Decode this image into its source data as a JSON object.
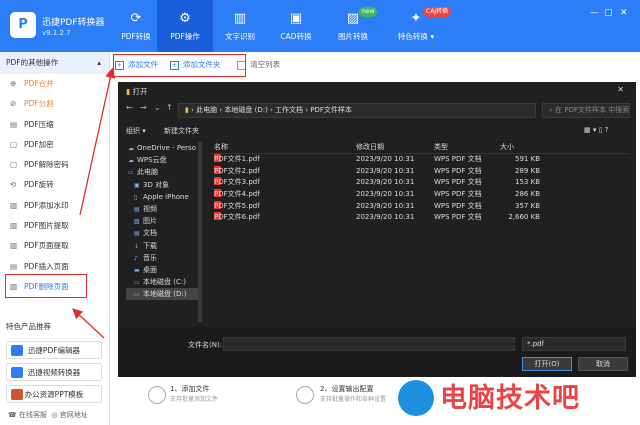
{
  "app": {
    "name": "迅捷PDF转换器",
    "version": "v9.1.2.7",
    "logo": "P"
  },
  "nav": [
    {
      "label": "PDF转换",
      "icon": "refresh-icon"
    },
    {
      "label": "PDF操作",
      "icon": "gear-icon"
    },
    {
      "label": "文字识别",
      "icon": "waveform-icon"
    },
    {
      "label": "CAD转换",
      "icon": "cad-icon"
    },
    {
      "label": "图片转换",
      "icon": "image-icon"
    },
    {
      "label": "特色转换",
      "icon": "special-icon",
      "dropdown": "▾"
    }
  ],
  "badges": {
    "new": "new",
    "caj": "CAJ转换"
  },
  "window": {
    "minimize": "—",
    "restore": "▢",
    "close": "✕"
  },
  "sidebar": {
    "header": "PDF的其他操作",
    "header_arrow": "▴",
    "items": [
      "PDF合并",
      "PDF分割",
      "PDF压缩",
      "PDF加密",
      "PDF解除密码",
      "PDF旋转",
      "PDF添加水印",
      "PDF图片提取",
      "PDF页面提取",
      "PDF插入页面",
      "PDF删除页面"
    ],
    "featured_header": "特色产品推荐",
    "featured": [
      "迅捷PDF编辑器",
      "迅捷视频转换器",
      "办公资源PPT模板"
    ],
    "footer": {
      "online": "在线客服",
      "website": "官网地址"
    }
  },
  "toolbar": {
    "add_file": "添加文件",
    "add_folder": "添加文件夹",
    "clear": "清空列表"
  },
  "dialog": {
    "title": "打开",
    "path": [
      "此电脑",
      "本地磁盘 (D:)",
      "工作文档",
      "PDF文件样本"
    ],
    "search_placeholder": "在 PDF文件样本 中搜索",
    "organize": "组织 ▾",
    "new_folder": "新建文件夹",
    "tree": [
      "OneDrive - Perso",
      "WPS云盘",
      "此电脑",
      "3D 对象",
      "Apple iPhone",
      "视频",
      "图片",
      "文档",
      "下载",
      "音乐",
      "桌面",
      "本地磁盘 (C:)",
      "本地磁盘 (D:)"
    ],
    "columns": [
      "名称",
      "修改日期",
      "类型",
      "大小"
    ],
    "files": [
      {
        "name": "PDF文件1.pdf",
        "date": "2023/9/20 10:31",
        "type": "WPS PDF 文档",
        "size": "591 KB"
      },
      {
        "name": "PDF文件2.pdf",
        "date": "2023/9/20 10:31",
        "type": "WPS PDF 文档",
        "size": "289 KB"
      },
      {
        "name": "PDF文件3.pdf",
        "date": "2023/9/20 10:31",
        "type": "WPS PDF 文档",
        "size": "153 KB"
      },
      {
        "name": "PDF文件4.pdf",
        "date": "2023/9/20 10:31",
        "type": "WPS PDF 文档",
        "size": "286 KB"
      },
      {
        "name": "PDF文件5.pdf",
        "date": "2023/9/20 10:31",
        "type": "WPS PDF 文档",
        "size": "357 KB"
      },
      {
        "name": "PDF文件6.pdf",
        "date": "2023/9/20 10:31",
        "type": "WPS PDF 文档",
        "size": "2,660 KB"
      }
    ],
    "filename_label": "文件名(N):",
    "filename_value": "",
    "filetype": "*.pdf",
    "open": "打开(O)",
    "cancel": "取消"
  },
  "steps": [
    {
      "title": "1、添加文件",
      "sub": "支持批量添加文件"
    },
    {
      "title": "2、设置输出配置",
      "sub": "支持批量操作和各种设置"
    }
  ],
  "watermark": "电脑技术吧",
  "colors": {
    "brand": "#2d7df7",
    "accent": "#e9823a",
    "highlight": "#e52c2c"
  }
}
